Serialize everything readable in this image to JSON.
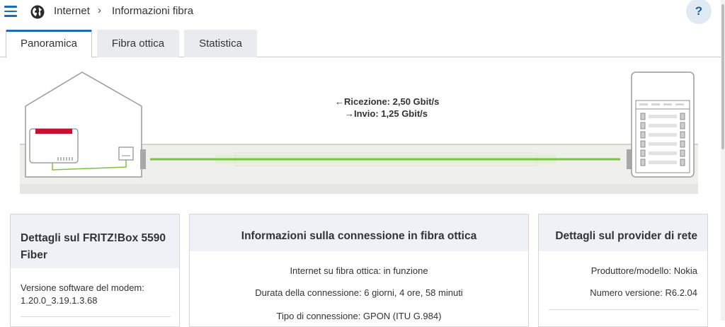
{
  "header": {
    "breadcrumb_root": "Internet",
    "breadcrumb_separator": "›",
    "breadcrumb_page": "Informazioni fibra",
    "help_label": "?"
  },
  "tabs": [
    {
      "label": "Panoramica",
      "active": true
    },
    {
      "label": "Fibra ottica",
      "active": false
    },
    {
      "label": "Statistica",
      "active": false
    }
  ],
  "diagram": {
    "rx_label": "Ricezione: 2,50 Gbit/s",
    "tx_label": "Invio: 1,25 Gbit/s",
    "rx_arrow": "←",
    "tx_arrow": "→",
    "line_color": "#7dc242",
    "router_accent": "#c8102e"
  },
  "cards": {
    "fritzbox": {
      "title": "Dettagli sul FRITZ!Box 5590 Fiber",
      "line1": "Versione software del modem:",
      "line2": "1.20.0_3.19.1.3.68"
    },
    "connection": {
      "title": "Informazioni sulla connessione in fibra ottica",
      "items": [
        "Internet su fibra ottica: in funzione",
        "Durata della connessione: 6 giorni, 4 ore, 58 minuti",
        "Tipo di connessione: GPON (ITU G.984)"
      ]
    },
    "provider": {
      "title": "Dettagli sul provider di rete",
      "items": [
        "Produttore/modello: Nokia",
        "Numero versione: R6.2.04"
      ]
    }
  }
}
